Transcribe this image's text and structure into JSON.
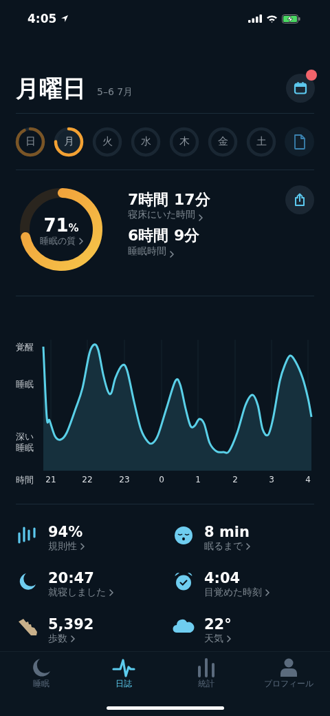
{
  "status_bar": {
    "time": "4:05"
  },
  "header": {
    "title": "月曜日",
    "date_range": "5–6 7月",
    "calendar_badge": true
  },
  "days": [
    {
      "label": "日",
      "selected": false,
      "has_data": true
    },
    {
      "label": "月",
      "selected": true,
      "has_data": true
    },
    {
      "label": "火",
      "selected": false,
      "has_data": false
    },
    {
      "label": "水",
      "selected": false,
      "has_data": false
    },
    {
      "label": "木",
      "selected": false,
      "has_data": false
    },
    {
      "label": "金",
      "selected": false,
      "has_data": false
    },
    {
      "label": "土",
      "selected": false,
      "has_data": false
    }
  ],
  "summary": {
    "quality": {
      "value": "71",
      "unit": "%",
      "label": "睡眠の質"
    },
    "metrics": [
      {
        "value": "7時間 17分",
        "label": "寝床にいた時間"
      },
      {
        "value": "6時間 9分",
        "label": "睡眠時間"
      }
    ]
  },
  "hypnogram": {
    "y_labels": [
      "覚醒",
      "睡眠",
      "深い睡眠"
    ],
    "x_title": "時間",
    "x_labels": [
      "21",
      "22",
      "23",
      "0",
      "1",
      "2",
      "3",
      "4"
    ]
  },
  "stats": [
    {
      "value": "94%",
      "label": "規則性"
    },
    {
      "value": "8 min",
      "label": "眠るまで"
    },
    {
      "value": "20:47",
      "label": "就寝しました"
    },
    {
      "value": "4:04",
      "label": "目覚めた時刻"
    },
    {
      "value": "5,392",
      "label": "歩数"
    },
    {
      "value": "22°",
      "label": "天気"
    }
  ],
  "tabs": [
    {
      "label": "睡眠",
      "selected": false
    },
    {
      "label": "日誌",
      "selected": true
    },
    {
      "label": "統計",
      "selected": false
    },
    {
      "label": "プロフィール",
      "selected": false
    }
  ]
}
